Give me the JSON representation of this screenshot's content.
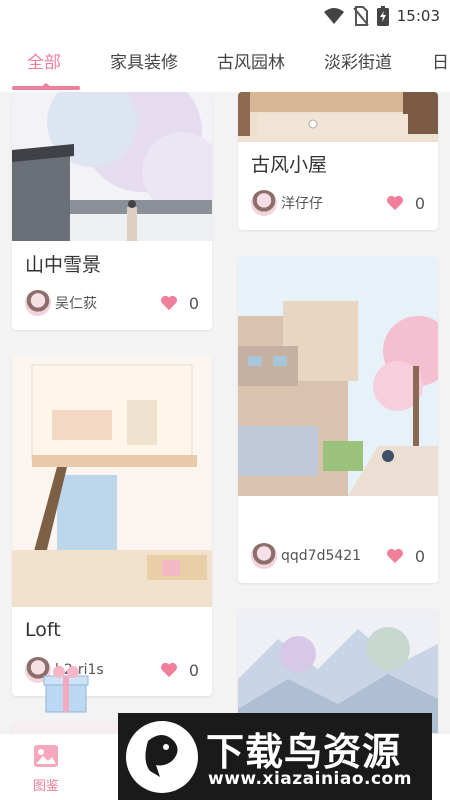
{
  "status_bar": {
    "time": "15:03",
    "icons": [
      "wifi-icon",
      "no-sim-icon",
      "battery-charging-icon"
    ]
  },
  "tabs": [
    {
      "label": "全部",
      "active": true
    },
    {
      "label": "家具装修",
      "active": false
    },
    {
      "label": "古风园林",
      "active": false
    },
    {
      "label": "淡彩街道",
      "active": false
    },
    {
      "label": "日",
      "active": false
    }
  ],
  "cards_left": [
    {
      "title": "山中雪景",
      "author": "吴仁荻",
      "likes": "0"
    },
    {
      "title": "Loft",
      "author": "h2-ri1s",
      "likes": "0"
    }
  ],
  "cards_right": [
    {
      "title": "古风小屋",
      "author": "洋仔仔",
      "likes": "0"
    },
    {
      "title": "",
      "author": "qqd7d5421",
      "likes": "0"
    }
  ],
  "bottom_nav": {
    "items": [
      {
        "label": "图鉴",
        "icon": "image-icon",
        "active": true
      }
    ]
  },
  "watermark": {
    "brand": "下载鸟资源",
    "url": "www.xiazainiao.com"
  },
  "colors": {
    "accent": "#f07f9c",
    "background": "#f3f3f3",
    "card": "#ffffff"
  }
}
